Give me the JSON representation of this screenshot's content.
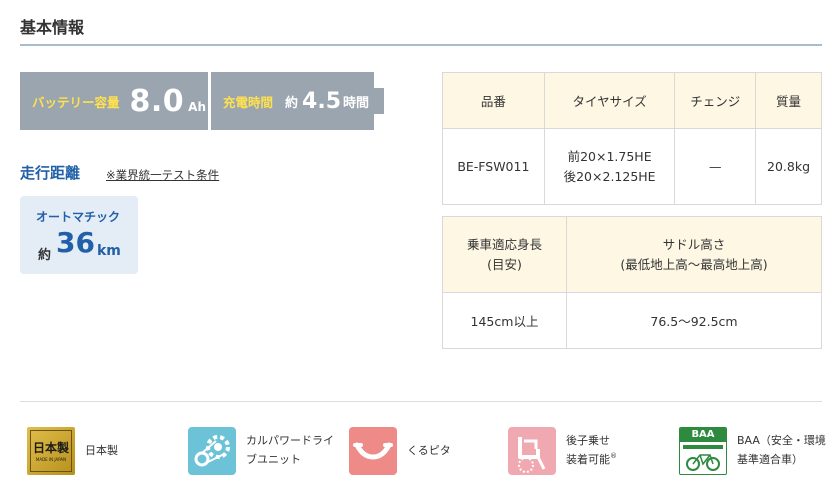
{
  "header": {
    "title": "基本情報"
  },
  "battery": {
    "capacity_label": "バッテリー容量",
    "capacity_value": "8.0",
    "capacity_unit": "Ah",
    "charge_label": "充電時間",
    "charge_prefix": "約",
    "charge_value": "4.5",
    "charge_unit": "時間"
  },
  "range": {
    "heading": "走行距離",
    "note": "※業界統一テスト条件",
    "mode": "オートマチック",
    "prefix": "約",
    "value": "36",
    "unit": "km"
  },
  "spec_table_1": {
    "headers": [
      "品番",
      "タイヤサイズ",
      "チェンジ",
      "質量"
    ],
    "row": {
      "model": "BE-FSW011",
      "tire_front": "前20×1.75HE",
      "tire_rear": "後20×2.125HE",
      "change": "—",
      "weight": "20.8kg"
    }
  },
  "spec_table_2": {
    "header_height_1": "乗車適応身長",
    "header_height_2": "(目安)",
    "header_saddle_1": "サドル高さ",
    "header_saddle_2": "(最低地上高〜最高地上高)",
    "row": {
      "height": "145cm以上",
      "saddle": "76.5〜92.5cm"
    }
  },
  "features": {
    "made_in_japan": {
      "label": "日本製",
      "logo_main": "日本製",
      "logo_sub": "MADE IN JAPAN",
      "color": "#c9a227"
    },
    "drive_unit": {
      "label_1": "カルパワードライ",
      "label_2": "ブユニット",
      "color": "#6cc3d8"
    },
    "kurupita": {
      "label": "くるピタ",
      "color": "#ee8a88"
    },
    "child_seat": {
      "label_1": "後子乗せ",
      "label_2": "装着可能",
      "mark": "®",
      "color": "#f0a9b0"
    },
    "baa": {
      "label_1": "BAA（安全・環境",
      "label_2": "基準適合車）",
      "logo_text": "BAA",
      "color": "#2e8a3e"
    }
  }
}
